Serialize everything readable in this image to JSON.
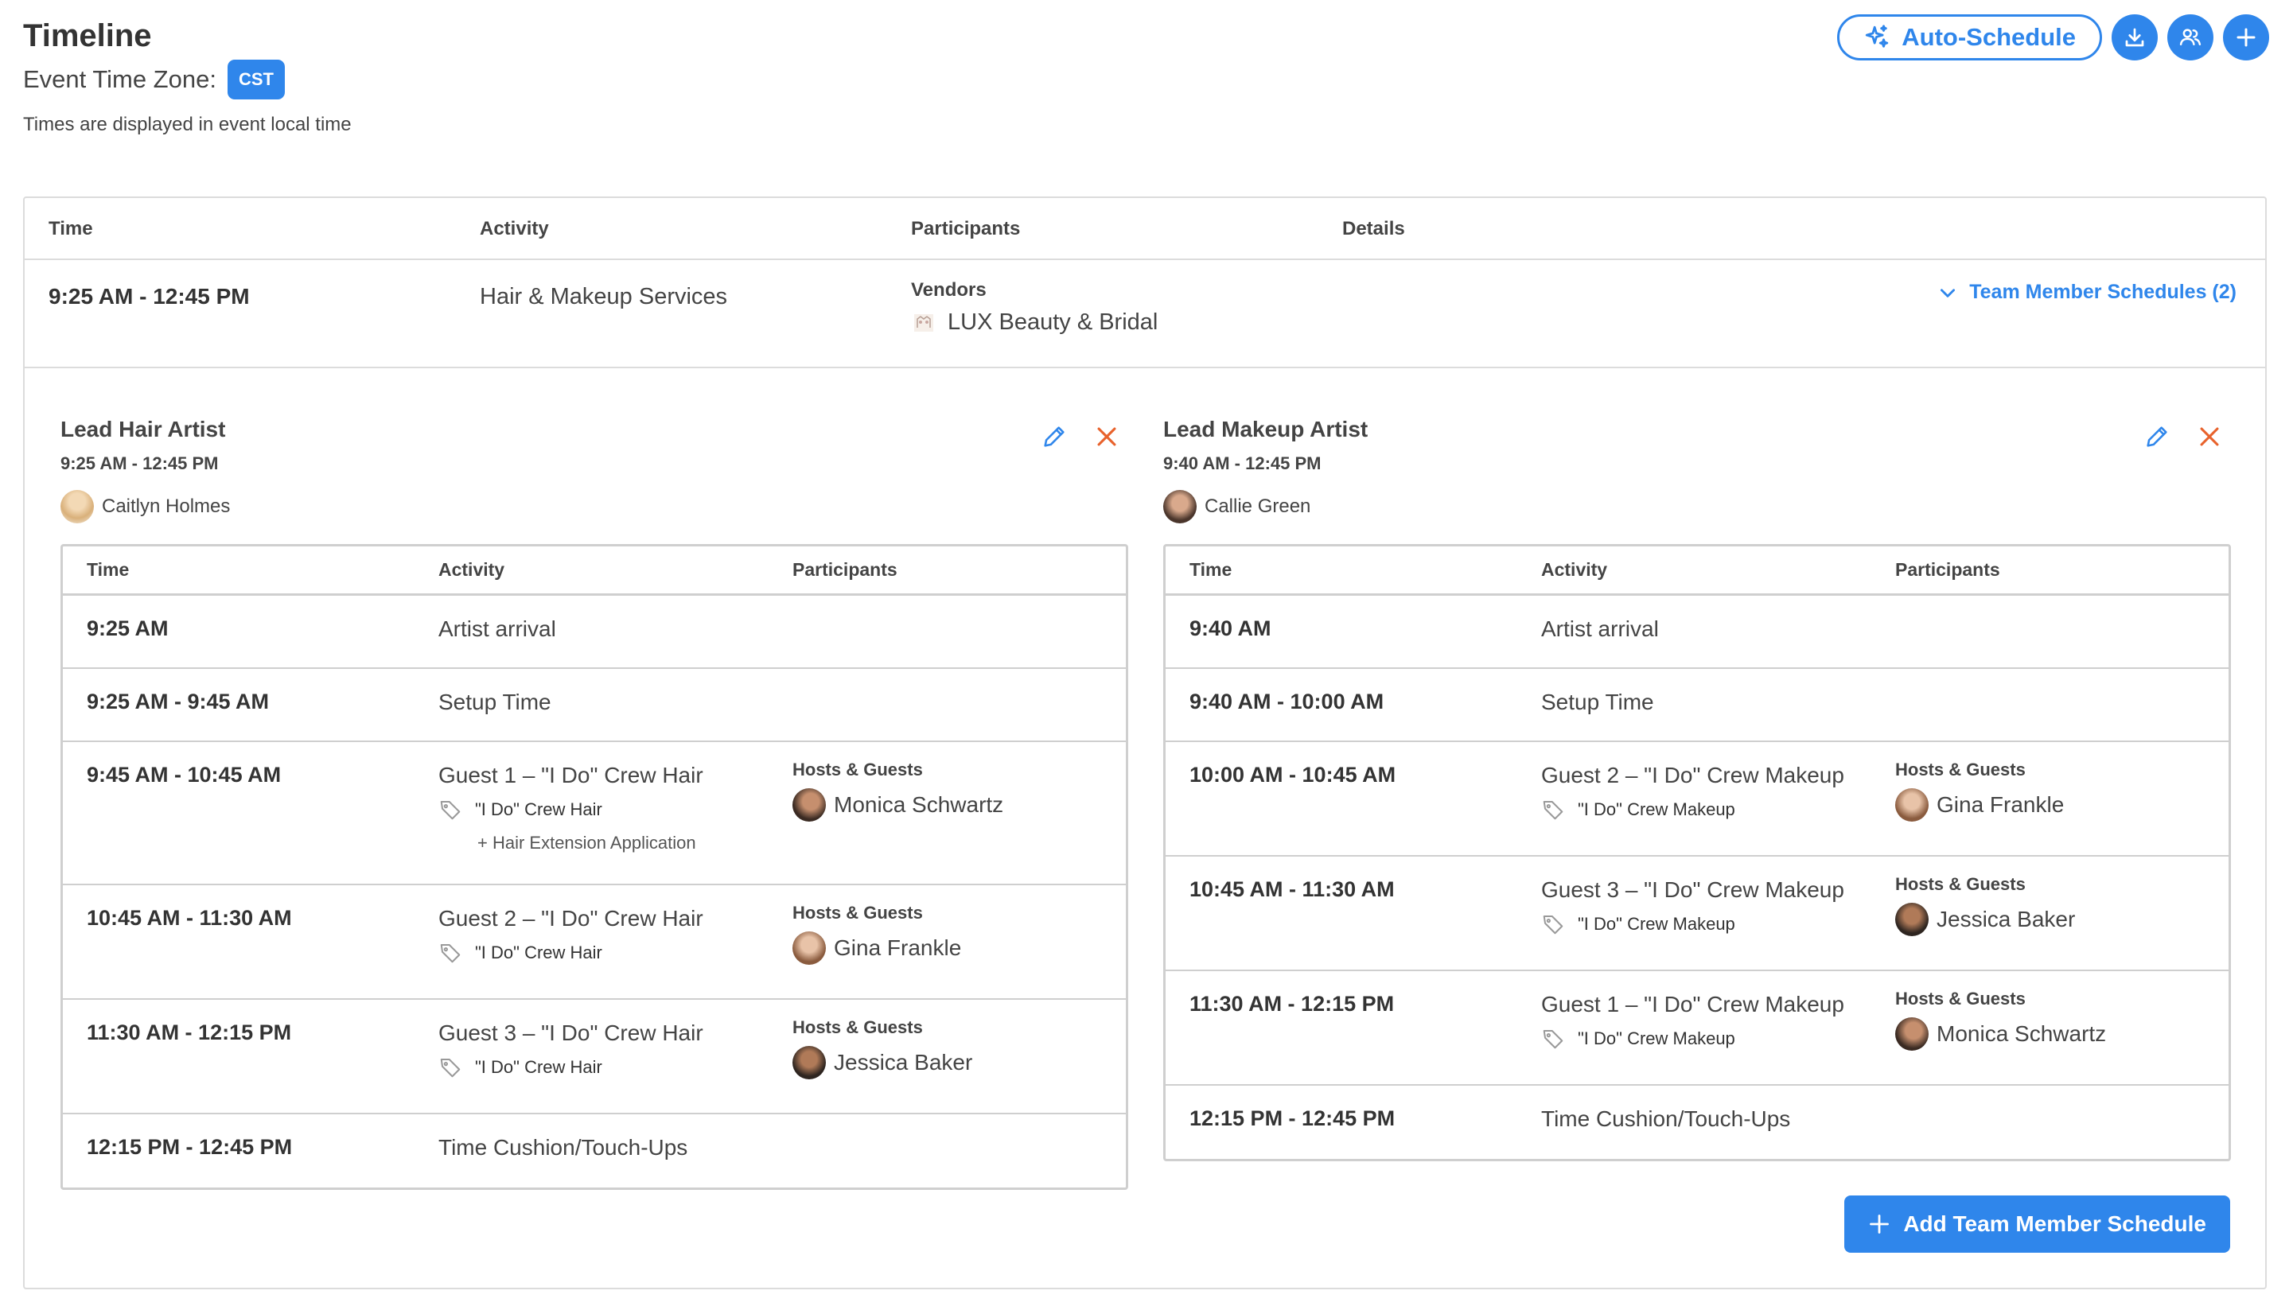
{
  "header": {
    "title": "Timeline",
    "timezone_label": "Event Time Zone:",
    "timezone_badge": "CST",
    "timezone_note": "Times are displayed in event local time"
  },
  "actions": {
    "auto_schedule_label": "Auto-Schedule",
    "icons": [
      "sparkle-icon",
      "download-icon",
      "people-icon",
      "plus-icon"
    ]
  },
  "table": {
    "headers": [
      "Time",
      "Activity",
      "Participants",
      "Details"
    ],
    "row": {
      "time": "9:25 AM - 12:45 PM",
      "activity": "Hair & Makeup Services",
      "vendors_label": "Vendors",
      "vendor_name": "LUX Beauty & Bridal",
      "team_schedules_label": "Team Member Schedules (2)"
    }
  },
  "schedules": [
    {
      "title": "Lead Hair Artist",
      "time": "9:25 AM - 12:45 PM",
      "person": "Caitlyn Holmes",
      "headers": [
        "Time",
        "Activity",
        "Participants"
      ],
      "rows": [
        {
          "time": "9:25 AM",
          "activity": "Artist arrival"
        },
        {
          "time": "9:25 AM - 9:45 AM",
          "activity": "Setup Time"
        },
        {
          "time": "9:45 AM - 10:45 AM",
          "activity": "Guest 1 – \"I Do\" Crew Hair",
          "tag": "\"I Do\" Crew Hair",
          "extra": "+ Hair Extension Application",
          "hg_label": "Hosts & Guests",
          "hg_person": "Monica Schwartz"
        },
        {
          "time": "10:45 AM - 11:30 AM",
          "activity": "Guest 2 – \"I Do\" Crew Hair",
          "tag": "\"I Do\" Crew Hair",
          "hg_label": "Hosts & Guests",
          "hg_person": "Gina Frankle"
        },
        {
          "time": "11:30 AM - 12:15 PM",
          "activity": "Guest 3 – \"I Do\" Crew Hair",
          "tag": "\"I Do\" Crew Hair",
          "hg_label": "Hosts & Guests",
          "hg_person": "Jessica Baker"
        },
        {
          "time": "12:15 PM - 12:45 PM",
          "activity": "Time Cushion/Touch-Ups"
        }
      ]
    },
    {
      "title": "Lead Makeup Artist",
      "time": "9:40 AM - 12:45 PM",
      "person": "Callie Green",
      "headers": [
        "Time",
        "Activity",
        "Participants"
      ],
      "rows": [
        {
          "time": "9:40 AM",
          "activity": "Artist arrival"
        },
        {
          "time": "9:40 AM - 10:00 AM",
          "activity": "Setup Time"
        },
        {
          "time": "10:00 AM - 10:45 AM",
          "activity": "Guest 2 – \"I Do\" Crew Makeup",
          "tag": "\"I Do\" Crew Makeup",
          "hg_label": "Hosts & Guests",
          "hg_person": "Gina Frankle"
        },
        {
          "time": "10:45 AM - 11:30 AM",
          "activity": "Guest 3 – \"I Do\" Crew Makeup",
          "tag": "\"I Do\" Crew Makeup",
          "hg_label": "Hosts & Guests",
          "hg_person": "Jessica Baker"
        },
        {
          "time": "11:30 AM - 12:15 PM",
          "activity": "Guest 1 – \"I Do\" Crew Makeup",
          "tag": "\"I Do\" Crew Makeup",
          "hg_label": "Hosts & Guests",
          "hg_person": "Monica Schwartz"
        },
        {
          "time": "12:15 PM - 12:45 PM",
          "activity": "Time Cushion/Touch-Ups"
        }
      ]
    }
  ],
  "add_button_label": "Add Team Member Schedule",
  "colors": {
    "accent": "#2f86eb",
    "danger": "#e8622c"
  }
}
